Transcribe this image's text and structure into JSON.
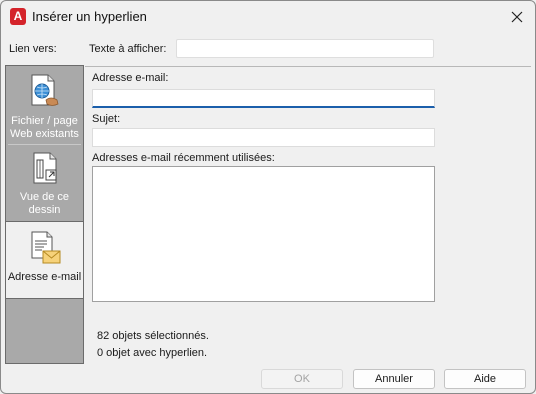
{
  "window": {
    "title": "Insérer un hyperlien",
    "app_icon_letter": "A",
    "app_icon_color": "#d4232a"
  },
  "link_to": {
    "label": "Lien vers:",
    "items": [
      {
        "label": "Fichier / page Web existants",
        "icon": "web-page-icon",
        "selected": false
      },
      {
        "label": "Vue de ce dessin",
        "icon": "drawing-view-icon",
        "selected": false
      },
      {
        "label": "Adresse e-mail",
        "icon": "email-icon",
        "selected": true
      }
    ]
  },
  "text_to_display": {
    "label": "Texte à afficher:",
    "value": ""
  },
  "email": {
    "address_label": "Adresse e-mail:",
    "address_value": "",
    "subject_label": "Sujet:",
    "subject_value": "",
    "recent_label": "Adresses e-mail récemment utilisées:",
    "recent_items": []
  },
  "status": {
    "selected_objects": "82 objets sélectionnés.",
    "with_hyperlink": "0 objet avec hyperlien."
  },
  "buttons": {
    "ok": "OK",
    "cancel": "Annuler",
    "help": "Aide"
  },
  "colors": {
    "accent": "#1b5fab",
    "sidebar": "#a9a9a9"
  }
}
